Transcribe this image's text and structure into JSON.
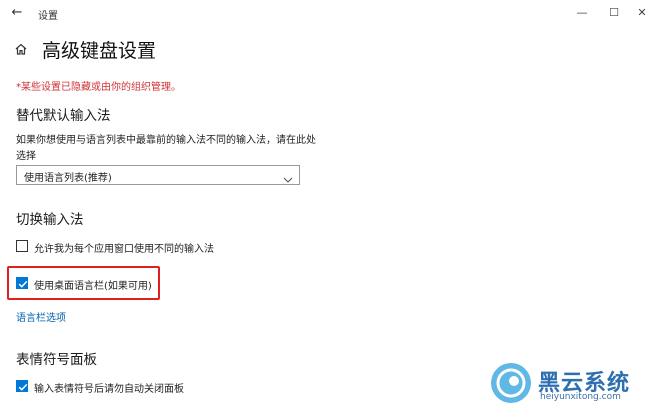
{
  "window": {
    "title": "设置",
    "back_glyph": "←",
    "minimize_glyph": "—",
    "maximize_glyph": "☐",
    "close_glyph": "✕"
  },
  "header": {
    "page_title": "高级键盘设置",
    "managed_note": "*某些设置已隐藏或由你的组织管理。"
  },
  "override_input": {
    "heading": "替代默认输入法",
    "description": "如果你想使用与语言列表中最靠前的输入法不同的输入法，请在此处选择",
    "select_value": "使用语言列表(推荐)"
  },
  "switch_input": {
    "heading": "切换输入法",
    "per_app_label": "允许我为每个应用窗口使用不同的输入法",
    "per_app_checked": false,
    "desktop_langbar_label": "使用桌面语言栏(如果可用)",
    "desktop_langbar_checked": true,
    "langbar_options_link": "语言栏选项"
  },
  "emoji_panel": {
    "heading": "表情符号面板",
    "auto_close_label": "输入表情符号后请勿自动关闭面板",
    "auto_close_checked": true
  },
  "watermark": {
    "brand": "黑云系统",
    "url": "heiyunxitong.com"
  },
  "colors": {
    "accent": "#0078d7",
    "warning": "#d13438",
    "highlight": "#e02020",
    "link": "#0063b1"
  }
}
